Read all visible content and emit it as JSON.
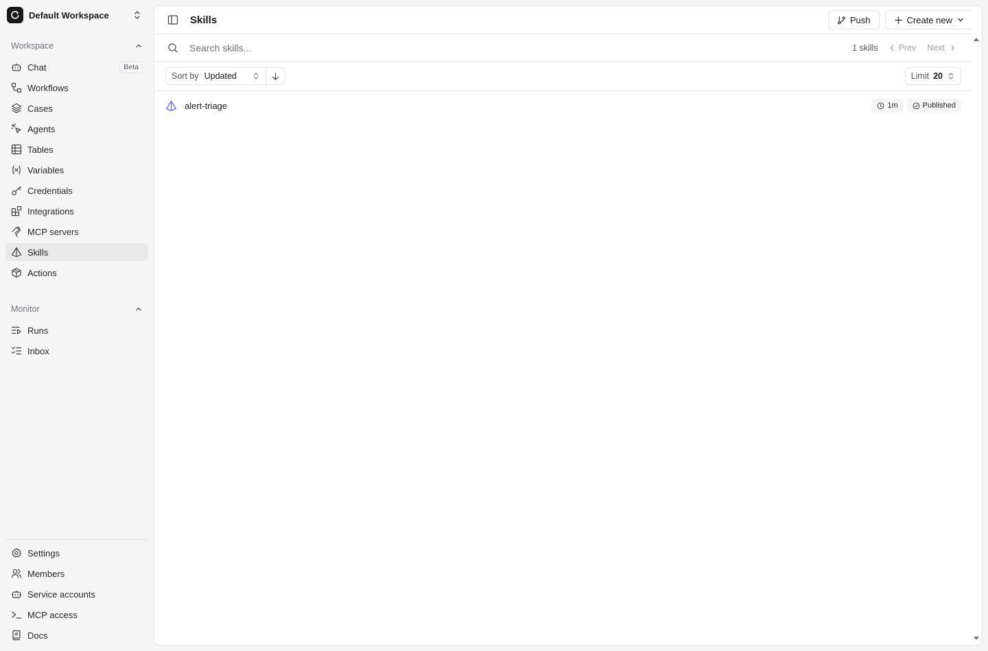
{
  "workspace": {
    "name": "Default Workspace"
  },
  "sidebar": {
    "workspace_group": {
      "label": "Workspace",
      "items": [
        {
          "label": "Chat",
          "icon": "bot-icon",
          "badge": "Beta"
        },
        {
          "label": "Workflows",
          "icon": "workflow-icon"
        },
        {
          "label": "Cases",
          "icon": "layers-icon"
        },
        {
          "label": "Agents",
          "icon": "sparkle-cursor-icon"
        },
        {
          "label": "Tables",
          "icon": "table-icon"
        },
        {
          "label": "Variables",
          "icon": "variable-icon"
        },
        {
          "label": "Credentials",
          "icon": "key-icon"
        },
        {
          "label": "Integrations",
          "icon": "blocks-icon"
        },
        {
          "label": "MCP servers",
          "icon": "mcp-icon"
        },
        {
          "label": "Skills",
          "icon": "skill-icon",
          "active": true
        },
        {
          "label": "Actions",
          "icon": "box-icon"
        }
      ]
    },
    "monitor_group": {
      "label": "Monitor",
      "items": [
        {
          "label": "Runs",
          "icon": "runs-icon"
        },
        {
          "label": "Inbox",
          "icon": "inbox-list-icon"
        }
      ]
    },
    "footer_items": [
      {
        "label": "Settings",
        "icon": "gear-icon"
      },
      {
        "label": "Members",
        "icon": "users-icon"
      },
      {
        "label": "Service accounts",
        "icon": "bot-icon"
      },
      {
        "label": "MCP access",
        "icon": "terminal-icon"
      },
      {
        "label": "Docs",
        "icon": "book-icon"
      }
    ]
  },
  "header": {
    "title": "Skills",
    "push_label": "Push",
    "create_label": "Create new"
  },
  "search": {
    "placeholder": "Search skills...",
    "count_label": "1 skills",
    "prev_label": "Prev",
    "next_label": "Next"
  },
  "filters": {
    "sort_prefix": "Sort by",
    "sort_value": "Updated",
    "sort_direction": "descending",
    "limit_prefix": "Limit",
    "limit_value": "20"
  },
  "skills": [
    {
      "name": "alert-triage",
      "age": "1m",
      "status": "Published"
    }
  ],
  "colors": {
    "accent": "#6366f1",
    "active_bg": "#e9e9ea",
    "border": "#e4e4e7"
  }
}
